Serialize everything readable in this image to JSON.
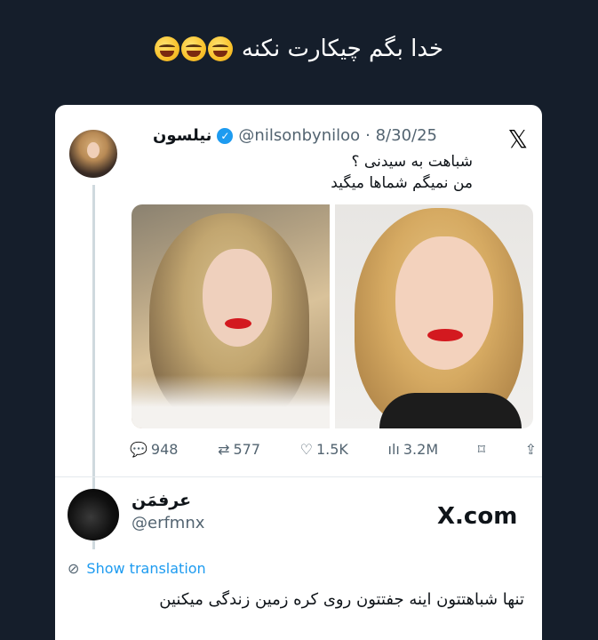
{
  "caption": {
    "text": "خدا بگم چیکارت نکنه",
    "emoji": [
      "rolling-laughing-emoji",
      "rolling-laughing-emoji",
      "rolling-laughing-emoji"
    ]
  },
  "tweet": {
    "display_name": "نیلسون",
    "handle": "@nilsonbyniloo",
    "date": "· 8/30/25",
    "line1": "شباهت به سیدنی ؟",
    "line2": "من نمیگم شماها میگید",
    "stats": {
      "replies": "948",
      "reposts": "577",
      "likes": "1.5K",
      "views": "3.2M"
    }
  },
  "reply": {
    "display_name": "عرفمَن",
    "handle": "@erfmnx",
    "source": "X.com",
    "translate_label": "Show translation",
    "text": "تنها شباهتتون اینه جفتتون روی کره زمین زندگی میکنین"
  },
  "colors": {
    "background": "#151e2b",
    "accent": "#1d9bf0",
    "muted": "#536471"
  }
}
